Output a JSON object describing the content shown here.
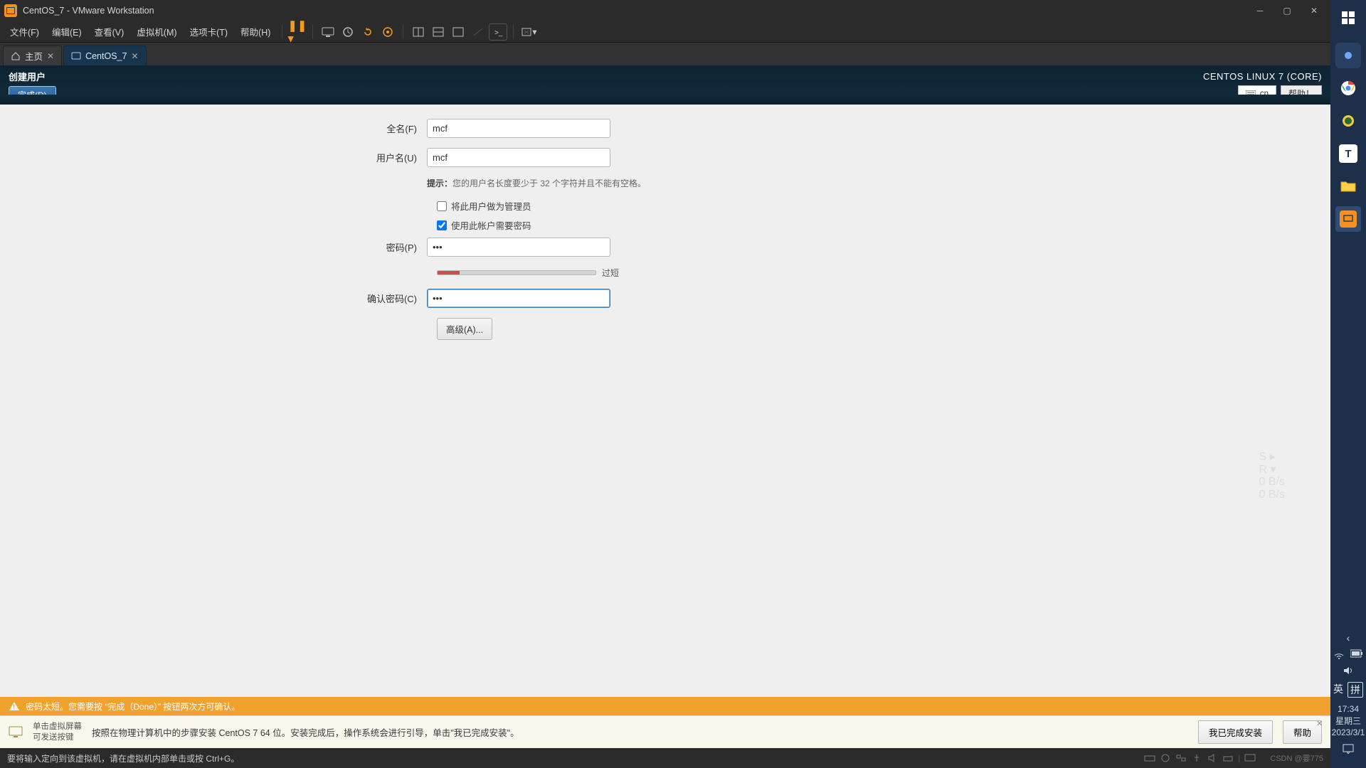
{
  "window": {
    "title": "CentOS_7 - VMware Workstation",
    "menus": [
      "文件(F)",
      "编辑(E)",
      "查看(V)",
      "虚拟机(M)",
      "选项卡(T)",
      "帮助(H)"
    ],
    "tabs": {
      "home": "主页",
      "vm": "CentOS_7"
    }
  },
  "installer": {
    "page_title": "创建用户",
    "done_btn": "完成(D)",
    "distro": "CENTOS LINUX 7 (CORE)",
    "keyboard_indicator": "cn",
    "help_btn": "帮助！",
    "labels": {
      "fullname": "全名(F)",
      "username": "用户名(U)",
      "password": "密码(P)",
      "confirm": "确认密码(C)"
    },
    "values": {
      "fullname": "mcf",
      "username": "mcf",
      "password": "•••",
      "confirm": "•••"
    },
    "hint_prefix": "提示：",
    "hint_text": "您的用户名长度要少于 32 个字符并且不能有空格。",
    "chk_admin": "将此用户做为管理员",
    "chk_require_pw": "使用此帐户需要密码",
    "strength_label": "过短",
    "advanced_btn": "高级(A)...",
    "warning_text": "密码太短。您需要按 “完成（Done）” 按钮两次方可确认。"
  },
  "vm_hint": {
    "lead_line1": "单击虚拟屏幕",
    "lead_line2": "可发送按键",
    "message": "按照在物理计算机中的步骤安装 CentOS 7 64 位。安装完成后，操作系统会进行引导，单击\"我已完成安装\"。",
    "btn_done": "我已完成安装",
    "btn_help": "帮助"
  },
  "vm_status": {
    "text": "要将输入定向到该虚拟机，请在虚拟机内部单击或按 Ctrl+G。",
    "watermark": "CSDN @霎775"
  },
  "net_widget": {
    "s": "S",
    "r": "R",
    "up": "0 B/s",
    "down": "0 B/s"
  },
  "win": {
    "ime1": "英",
    "ime2": "拼",
    "time": "17:34",
    "weekday": "星期三",
    "date": "2023/3/1"
  }
}
